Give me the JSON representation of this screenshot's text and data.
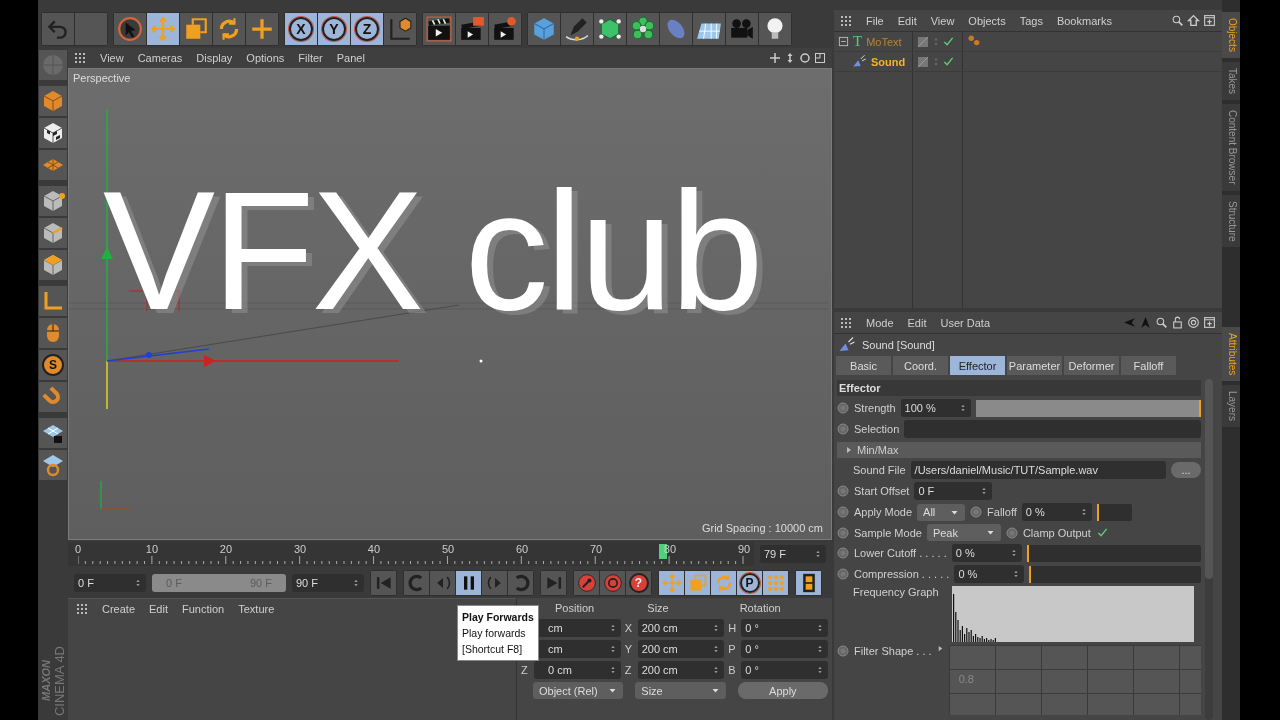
{
  "toolbar": {
    "groups": [
      [
        {
          "kind": "undo",
          "selected": false
        },
        {
          "kind": "blank",
          "selected": false
        }
      ],
      [
        {
          "kind": "select",
          "selected": false
        },
        {
          "kind": "move",
          "selected": true
        },
        {
          "kind": "scale",
          "selected": false
        },
        {
          "kind": "rotate",
          "selected": false
        },
        {
          "kind": "plus",
          "selected": false
        }
      ],
      [
        {
          "kind": "letter",
          "label": "X",
          "selected": true
        },
        {
          "kind": "letter",
          "label": "Y",
          "selected": true
        },
        {
          "kind": "letter",
          "label": "Z",
          "selected": true
        },
        {
          "kind": "coord",
          "selected": false
        }
      ],
      [
        {
          "kind": "render_view",
          "selected": false
        },
        {
          "kind": "render_picture",
          "selected": false
        },
        {
          "kind": "render_settings",
          "selected": false
        }
      ],
      [
        {
          "kind": "cube",
          "selected": false
        },
        {
          "kind": "pen",
          "selected": false
        },
        {
          "kind": "cloner",
          "selected": false
        },
        {
          "kind": "flower",
          "selected": false
        },
        {
          "kind": "deform",
          "selected": false
        },
        {
          "kind": "floor",
          "selected": false
        },
        {
          "kind": "camera",
          "selected": false
        },
        {
          "kind": "bulb",
          "selected": false
        }
      ]
    ]
  },
  "left_toolbar": {
    "groups": [
      [
        {
          "kind": "sphere",
          "selected": false
        }
      ],
      [
        {
          "kind": "box",
          "selected": false
        },
        {
          "kind": "checker",
          "selected": false
        },
        {
          "kind": "grid",
          "selected": false
        }
      ],
      [
        {
          "kind": "points",
          "selected": false
        },
        {
          "kind": "edges",
          "selected": false
        },
        {
          "kind": "polys",
          "selected": false
        }
      ],
      [
        {
          "kind": "axis",
          "selected": false
        },
        {
          "kind": "mouse",
          "selected": false
        },
        {
          "kind": "letter",
          "label": "S",
          "selected": false
        },
        {
          "kind": "magnet",
          "selected": false
        }
      ],
      [
        {
          "kind": "lockgrid",
          "selected": false
        },
        {
          "kind": "wrapgrid",
          "selected": false
        }
      ]
    ]
  },
  "logo": {
    "brand": "MAXON",
    "product": "CINEMA 4D"
  },
  "viewport": {
    "menu": [
      "View",
      "Cameras",
      "Display",
      "Options",
      "Filter",
      "Panel"
    ],
    "camera": "Perspective",
    "scene_text": "VFX club",
    "grid_spacing": "Grid Spacing : 10000 cm"
  },
  "timeline": {
    "labels": [
      "0",
      "10",
      "20",
      "30",
      "40",
      "50",
      "60",
      "70",
      "80",
      "90"
    ],
    "level": 0.878,
    "current": "79 F"
  },
  "transport": {
    "start": "0 F",
    "range_start": "0 F",
    "range_end": "90 F",
    "end": "90 F",
    "groups": [
      [
        {
          "kind": "first",
          "selected": false
        }
      ],
      [
        {
          "kind": "prevkey",
          "selected": false
        },
        {
          "kind": "prevframe",
          "selected": false
        },
        {
          "kind": "play",
          "selected": true
        },
        {
          "kind": "nextframe",
          "selected": false
        },
        {
          "kind": "nextkey",
          "selected": false
        }
      ],
      [
        {
          "kind": "last",
          "selected": false
        }
      ],
      [
        {
          "kind": "record",
          "selected": false
        },
        {
          "kind": "autokey",
          "selected": false
        },
        {
          "kind": "red_letter",
          "label": "?",
          "selected": false
        }
      ],
      [
        {
          "kind": "move",
          "selected": true
        },
        {
          "kind": "scale",
          "selected": true
        },
        {
          "kind": "rotate",
          "selected": true
        },
        {
          "kind": "letter",
          "label": "P",
          "selected": true
        },
        {
          "kind": "dots",
          "selected": true
        }
      ],
      [
        {
          "kind": "film",
          "selected": true
        }
      ]
    ]
  },
  "tooltip": {
    "title": "Play Forwards",
    "text": "Play forwards",
    "shortcut": "[Shortcut F8]"
  },
  "material_manager": {
    "menu": [
      "Create",
      "Edit",
      "Function",
      "Texture"
    ]
  },
  "coordinates": {
    "headers": [
      "Position",
      "Size",
      "Rotation"
    ],
    "rows": [
      [
        {
          "value": "cm"
        },
        {
          "axis": "X",
          "value": "200 cm"
        },
        {
          "axis": "H",
          "value": "0 °"
        }
      ],
      [
        {
          "value": "cm"
        },
        {
          "axis": "Y",
          "value": "200 cm"
        },
        {
          "axis": "P",
          "value": "0 °"
        }
      ],
      [
        {
          "axis": "Z",
          "value": "0 cm"
        },
        {
          "axis": "Z",
          "value": "200 cm"
        },
        {
          "axis": "B",
          "value": "0 °"
        }
      ]
    ],
    "dropdowns": [
      "Object (Rel)",
      "Size"
    ],
    "apply": "Apply"
  },
  "object_manager": {
    "menu": [
      "File",
      "Edit",
      "View",
      "Objects",
      "Tags",
      "Bookmarks"
    ],
    "objects": [
      {
        "name": "MoText",
        "kind": "text",
        "glyph": "T",
        "selected": false,
        "expanded": true,
        "enabled": true,
        "tags": [
          {
            "kind": "selection"
          }
        ],
        "children": [
          {
            "name": "Sound",
            "kind": "sound",
            "selected": true,
            "enabled": true
          }
        ]
      }
    ]
  },
  "side_tabs_top": [
    {
      "label": "Objects",
      "selected": true
    },
    {
      "label": "Takes",
      "selected": false
    },
    {
      "label": "Content Browser",
      "selected": false
    },
    {
      "label": "Structure",
      "selected": false
    }
  ],
  "side_tabs_bottom": [
    {
      "label": "Attributes",
      "selected": true
    },
    {
      "label": "Layers",
      "selected": false
    }
  ],
  "attributes": {
    "menu": [
      "Mode",
      "Edit",
      "User Data"
    ],
    "title": "Sound [Sound]",
    "tabs": [
      {
        "label": "Basic",
        "selected": false
      },
      {
        "label": "Coord.",
        "selected": false
      },
      {
        "label": "Effector",
        "selected": true
      },
      {
        "label": "Parameter",
        "selected": false
      },
      {
        "label": "Deformer",
        "selected": false
      },
      {
        "label": "Falloff",
        "selected": false
      }
    ],
    "rows": [
      {
        "kind": "section",
        "label": "Effector"
      },
      {
        "kind": "slider",
        "label": "Strength",
        "value": "100 %",
        "level": 1
      },
      {
        "kind": "field",
        "label": "Selection"
      },
      {
        "kind": "group",
        "label": "Min/Max",
        "expanded": false
      },
      {
        "kind": "file",
        "label": "Sound File",
        "value": "/Users/daniel/Music/TUT/Sample.wav",
        "button": "..."
      },
      {
        "kind": "number",
        "label": "Start Offset",
        "value": "0 F"
      },
      {
        "kind": "mode",
        "label": "Apply Mode",
        "option": "All",
        "sub_label": "Falloff",
        "value": "0 %",
        "level": 0
      },
      {
        "kind": "check",
        "label": "Sample Mode",
        "option": "Peak",
        "sub_label": "Clamp Output",
        "checked": true
      },
      {
        "kind": "slider",
        "label": "Lower Cutoff . . . . .",
        "value": "0 %",
        "level": 0
      },
      {
        "kind": "slider",
        "label": "Compression . . . . .",
        "value": "0 %",
        "level": 0
      },
      {
        "kind": "graph",
        "label": "Frequency Graph"
      },
      {
        "kind": "filter",
        "label": "Filter Shape . . .",
        "tick": "0.8"
      }
    ]
  }
}
